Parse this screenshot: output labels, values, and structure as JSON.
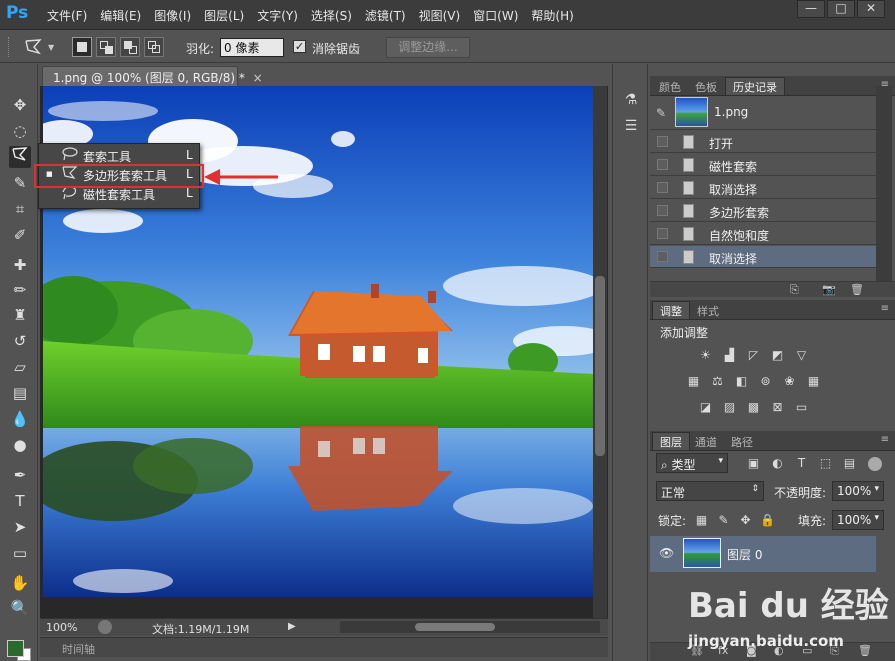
{
  "app": {
    "logo": "Ps",
    "menu": [
      "文件(F)",
      "编辑(E)",
      "图像(I)",
      "图层(L)",
      "文字(Y)",
      "选择(S)",
      "滤镜(T)",
      "视图(V)",
      "窗口(W)",
      "帮助(H)"
    ],
    "window_buttons": [
      "—",
      "□",
      "✕"
    ]
  },
  "options": {
    "feather_label": "羽化:",
    "feather_value": "0 像素",
    "antialias_checked": "✓",
    "antialias_label": "消除锯齿",
    "refine_edge": "调整边缘..."
  },
  "document": {
    "tab_title": "1.png @ 100% (图层 0, RGB/8) *",
    "close": "×",
    "zoom": "100%",
    "doc_info": "文档:1.19M/1.19M",
    "timeline": "时间轴"
  },
  "flyout": {
    "items": [
      {
        "label": "套索工具",
        "key": "L",
        "icon": "lasso-icon",
        "selected": ""
      },
      {
        "label": "多边形套索工具",
        "key": "L",
        "icon": "polygonal-lasso-icon",
        "selected": "■"
      },
      {
        "label": "磁性套索工具",
        "key": "L",
        "icon": "magnetic-lasso-icon",
        "selected": ""
      }
    ]
  },
  "history_panel": {
    "tabs": [
      "颜色",
      "色板",
      "历史记录"
    ],
    "active_tab": "历史记录",
    "snapshot": "1.png",
    "items": [
      {
        "label": "打开",
        "selected": false
      },
      {
        "label": "磁性套索",
        "selected": false
      },
      {
        "label": "取消选择",
        "selected": false
      },
      {
        "label": "多边形套索",
        "selected": false
      },
      {
        "label": "自然饱和度",
        "selected": false
      },
      {
        "label": "取消选择",
        "selected": true
      }
    ]
  },
  "adjust_panel": {
    "tabs": [
      "调整",
      "样式"
    ],
    "active_tab": "调整",
    "title": "添加调整"
  },
  "layers_panel": {
    "tabs": [
      "图层",
      "通道",
      "路径"
    ],
    "active_tab": "图层",
    "filter_kind": "类型",
    "blend_mode": "正常",
    "opacity_label": "不透明度:",
    "opacity_value": "100%",
    "lock_label": "锁定:",
    "fill_label": "填充:",
    "fill_value": "100%",
    "layers": [
      {
        "name": "图层 0",
        "visible": true
      }
    ]
  },
  "watermark": {
    "logo": "Bai du 经验",
    "url": "jingyan.baidu.com"
  },
  "colors": {
    "highlight": "#e0312e",
    "foreground": "#2a6a2a",
    "background": "#ffffff",
    "selected_row": "#5d6c80"
  }
}
